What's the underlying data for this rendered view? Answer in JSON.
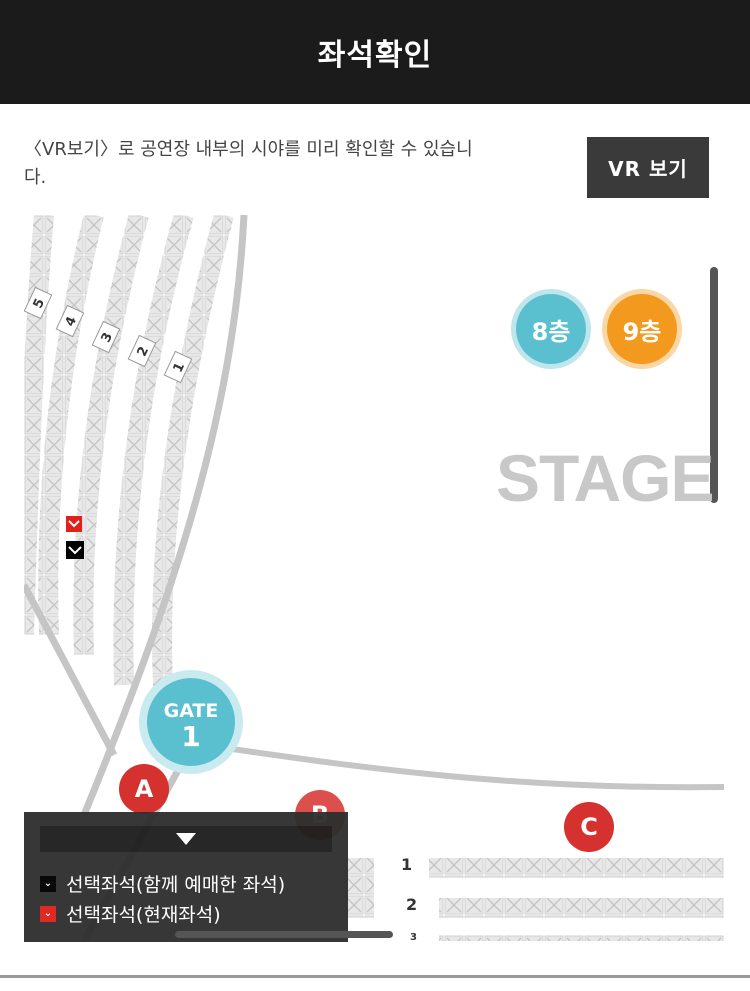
{
  "header": {
    "title": "좌석확인"
  },
  "intro": {
    "description": "〈VR보기〉로 공연장 내부의 시야를 미리 확인할 수 있습니다.",
    "vr_button_label": "VR 보기"
  },
  "map": {
    "floor_buttons": [
      {
        "label": "8층",
        "color": "#5ac0d0"
      },
      {
        "label": "9층",
        "color": "#f39a1e"
      }
    ],
    "stage_label": "STAGE",
    "gate": {
      "line1": "GATE",
      "line2": "1"
    },
    "sections": [
      "A",
      "B",
      "C"
    ],
    "side_row_numbers": [
      "5",
      "4",
      "3",
      "2",
      "1"
    ],
    "front_row_numbers": [
      "1",
      "2",
      "3"
    ]
  },
  "legend": {
    "items": [
      {
        "label": "선택좌석(함께 예매한 좌석)",
        "color": "#000000",
        "icon": "check-chevron-icon"
      },
      {
        "label": "선택좌석(현재좌석)",
        "color": "#e0201b",
        "icon": "check-chevron-icon"
      }
    ]
  },
  "colors": {
    "header_bg": "#1b1b1b",
    "accent_red": "#d5312e",
    "gate_teal": "#5ac0d0"
  }
}
